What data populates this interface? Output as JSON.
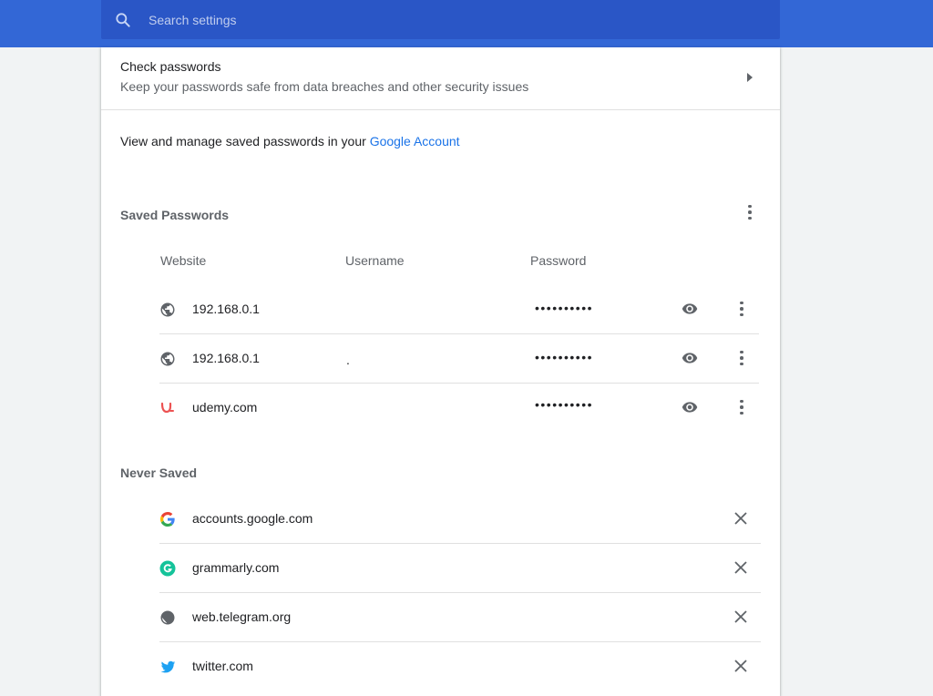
{
  "search": {
    "placeholder": "Search settings"
  },
  "check_passwords": {
    "title": "Check passwords",
    "subtitle": "Keep your passwords safe from data breaches and other security issues"
  },
  "manage": {
    "text": "View and manage saved passwords in your ",
    "link": "Google Account"
  },
  "saved_passwords": {
    "title": "Saved Passwords",
    "columns": {
      "website": "Website",
      "username": "Username",
      "password": "Password"
    },
    "rows": [
      {
        "site": "192.168.0.1",
        "username": "",
        "password": "••••••••••",
        "icon": "globe-icon"
      },
      {
        "site": "192.168.0.1",
        "username": ".",
        "password": "••••••••••",
        "icon": "globe-icon"
      },
      {
        "site": "udemy.com",
        "username": "",
        "password": "••••••••••",
        "icon": "udemy-icon"
      }
    ]
  },
  "never_saved": {
    "title": "Never Saved",
    "rows": [
      {
        "site": "accounts.google.com",
        "icon": "google-icon"
      },
      {
        "site": "grammarly.com",
        "icon": "grammarly-icon"
      },
      {
        "site": "web.telegram.org",
        "icon": "globe-icon"
      },
      {
        "site": "twitter.com",
        "icon": "twitter-icon"
      }
    ]
  },
  "colors": {
    "header": "#3367d6",
    "search_bg": "#2a56c6",
    "link": "#1a73e8",
    "udemy": "#ec5252",
    "grammarly": "#15c39a",
    "twitter": "#1da1f2"
  }
}
